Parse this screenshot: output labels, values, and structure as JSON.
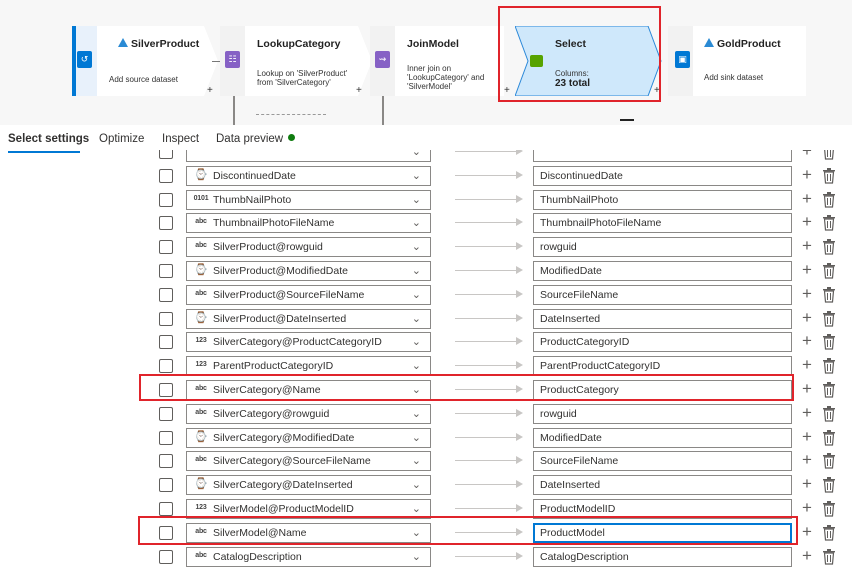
{
  "pipeline": {
    "nodes": [
      {
        "title": "SilverProduct",
        "sub": [
          "Add source dataset"
        ],
        "icon": "source-dataset-icon",
        "color": "#0078d4"
      },
      {
        "title": "LookupCategory",
        "sub": [
          "Lookup on 'SilverProduct'",
          "from 'SilverCategory'"
        ],
        "icon": "lookup-icon",
        "color": "#8661c5"
      },
      {
        "title": "JoinModel",
        "sub": [
          "Inner join on",
          "'LookupCategory' and",
          "'SilverModel'"
        ],
        "icon": "join-icon",
        "color": "#8661c5"
      },
      {
        "title": "Select",
        "sub": [
          "Columns:"
        ],
        "total": "23 total",
        "icon": "select-icon",
        "color": "#57a300"
      },
      {
        "title": "GoldProduct",
        "sub": [
          "Add sink dataset"
        ],
        "icon": "sink-dataset-icon",
        "color": "#0078d4"
      }
    ],
    "plus": "+"
  },
  "tabs": {
    "select_settings": "Select settings",
    "optimize": "Optimize",
    "inspect": "Inspect",
    "data_preview": "Data preview"
  },
  "mappings": [
    {
      "type": "date",
      "type_label": "",
      "source": "",
      "target": ""
    },
    {
      "type": "date",
      "type_label": "⌚",
      "source": "DiscontinuedDate",
      "target": "DiscontinuedDate"
    },
    {
      "type": "binary",
      "type_label": "0101",
      "source": "ThumbNailPhoto",
      "target": "ThumbNailPhoto"
    },
    {
      "type": "string",
      "type_label": "abc",
      "source": "ThumbnailPhotoFileName",
      "target": "ThumbnailPhotoFileName"
    },
    {
      "type": "string",
      "type_label": "abc",
      "source": "SilverProduct@rowguid",
      "target": "rowguid"
    },
    {
      "type": "date",
      "type_label": "⌚",
      "source": "SilverProduct@ModifiedDate",
      "target": "ModifiedDate"
    },
    {
      "type": "string",
      "type_label": "abc",
      "source": "SilverProduct@SourceFileName",
      "target": "SourceFileName"
    },
    {
      "type": "date",
      "type_label": "⌚",
      "source": "SilverProduct@DateInserted",
      "target": "DateInserted"
    },
    {
      "type": "integer",
      "type_label": "123",
      "source": "SilverCategory@ProductCategoryID",
      "target": "ProductCategoryID"
    },
    {
      "type": "integer",
      "type_label": "123",
      "source": "ParentProductCategoryID",
      "target": "ParentProductCategoryID"
    },
    {
      "type": "string",
      "type_label": "abc",
      "source": "SilverCategory@Name",
      "target": "ProductCategory"
    },
    {
      "type": "string",
      "type_label": "abc",
      "source": "SilverCategory@rowguid",
      "target": "rowguid"
    },
    {
      "type": "date",
      "type_label": "⌚",
      "source": "SilverCategory@ModifiedDate",
      "target": "ModifiedDate"
    },
    {
      "type": "string",
      "type_label": "abc",
      "source": "SilverCategory@SourceFileName",
      "target": "SourceFileName"
    },
    {
      "type": "date",
      "type_label": "⌚",
      "source": "SilverCategory@DateInserted",
      "target": "DateInserted"
    },
    {
      "type": "integer",
      "type_label": "123",
      "source": "SilverModel@ProductModelID",
      "target": "ProductModelID"
    },
    {
      "type": "string",
      "type_label": "abc",
      "source": "SilverModel@Name",
      "target": "ProductModel"
    },
    {
      "type": "string",
      "type_label": "abc",
      "source": "CatalogDescription",
      "target": "CatalogDescription"
    }
  ],
  "icons": {
    "chevron": "⌄",
    "add": "+",
    "delete": "trash-icon",
    "arrow": "mapping-arrow-icon"
  },
  "colors": {
    "highlight": "#e0242b",
    "accent": "#0078d4",
    "select_fill": "#cfe8fb",
    "status_ok": "#107c10"
  }
}
